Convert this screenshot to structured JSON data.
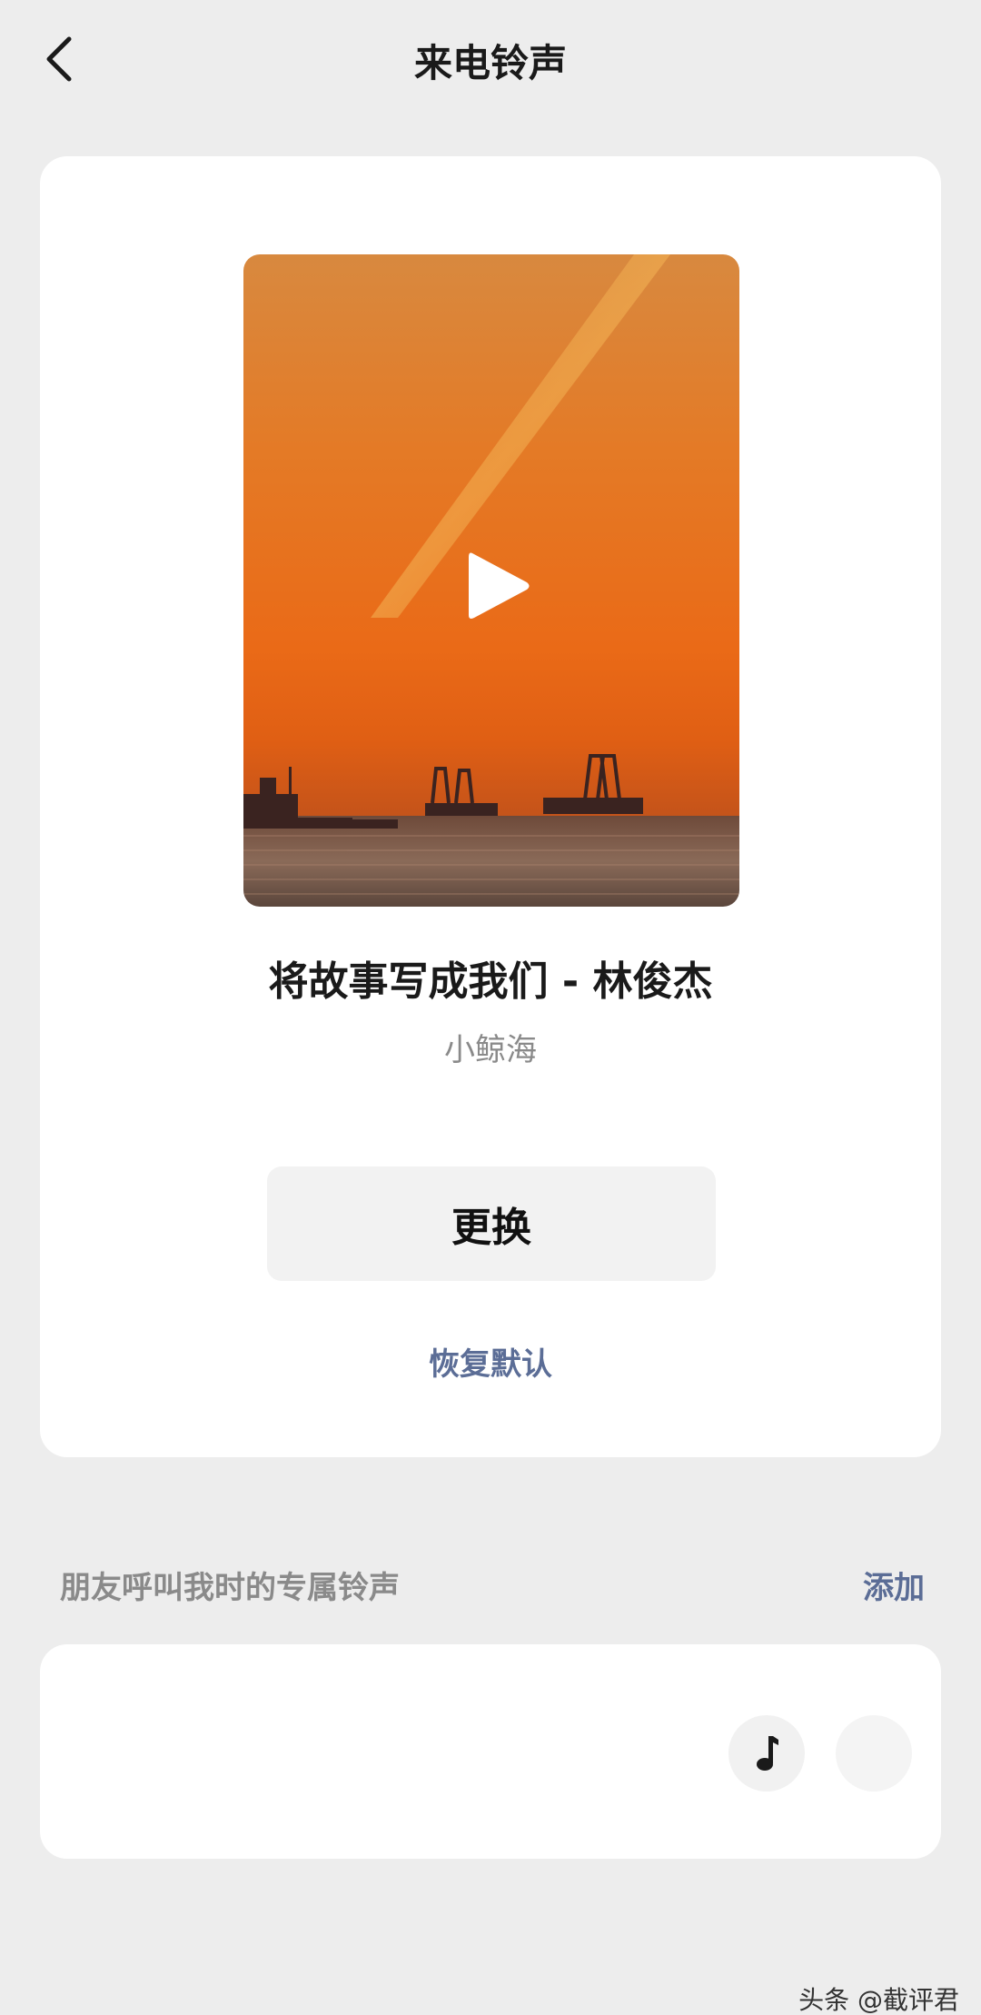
{
  "header": {
    "title": "来电铃声",
    "back_icon": "chevron-left-icon"
  },
  "ringtone": {
    "song_title": "将故事写成我们 - 林俊杰",
    "artist": "小鲸海",
    "play_icon": "play-icon",
    "change_label": "更换",
    "restore_label": "恢复默认"
  },
  "friends_section": {
    "label": "朋友呼叫我时的专属铃声",
    "add_label": "添加",
    "music_icon": "music-note-icon"
  },
  "watermark": "头条 @截评君",
  "colors": {
    "background": "#ededed",
    "card": "#ffffff",
    "accent_link": "#5b6d96",
    "secondary_text": "#8a8a8a"
  }
}
